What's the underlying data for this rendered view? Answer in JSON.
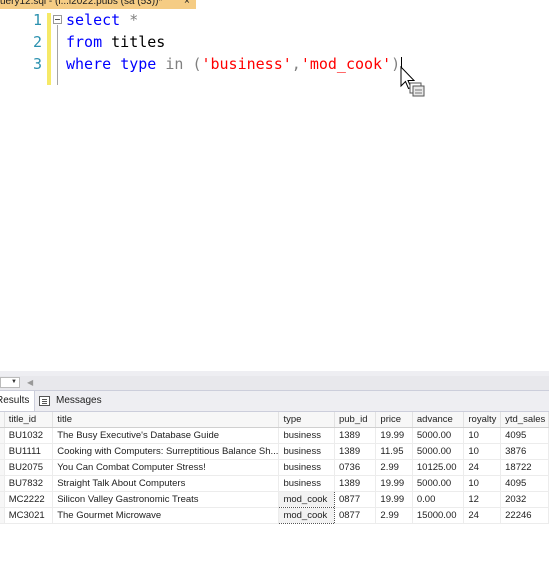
{
  "document_tab": {
    "label": "uery12.sql - (l...l2022.pubs (sa (53))*",
    "close": "×"
  },
  "editor": {
    "line_numbers": [
      "1",
      "2",
      "3"
    ],
    "lines": [
      [
        {
          "t": "select",
          "c": "kw"
        },
        {
          "t": " ",
          "c": "id"
        },
        {
          "t": "*",
          "c": "op"
        }
      ],
      [
        {
          "t": "from",
          "c": "kw"
        },
        {
          "t": " titles",
          "c": "id"
        }
      ],
      [
        {
          "t": "where",
          "c": "kw"
        },
        {
          "t": " ",
          "c": "id"
        },
        {
          "t": "type",
          "c": "kw"
        },
        {
          "t": " ",
          "c": "id"
        },
        {
          "t": "in",
          "c": "op"
        },
        {
          "t": " ",
          "c": "id"
        },
        {
          "t": "(",
          "c": "op"
        },
        {
          "t": "'business'",
          "c": "str"
        },
        {
          "t": ",",
          "c": "op"
        },
        {
          "t": "'mod_cook'",
          "c": "str"
        },
        {
          "t": ")",
          "c": "op"
        }
      ]
    ],
    "colors": {
      "keyword": "#0000ff",
      "operator": "#808080",
      "string": "#ff0000",
      "line_number": "#2b91af"
    }
  },
  "result_tabs": {
    "results_label": "Results",
    "messages_label": "Messages",
    "messages_icon": "messages-icon"
  },
  "grid": {
    "columns": [
      "title_id",
      "title",
      "type",
      "pub_id",
      "price",
      "advance",
      "royalty",
      "ytd_sales"
    ],
    "rows": [
      [
        "BU1032",
        "The Busy Executive's Database Guide",
        "business",
        "1389",
        "19.99",
        "5000.00",
        "10",
        "4095"
      ],
      [
        "BU1111",
        "Cooking with Computers: Surreptitious Balance Sh...",
        "business",
        "1389",
        "11.95",
        "5000.00",
        "10",
        "3876"
      ],
      [
        "BU2075",
        "You Can Combat Computer Stress!",
        "business",
        "0736",
        "2.99",
        "10125.00",
        "24",
        "18722"
      ],
      [
        "BU7832",
        "Straight Talk About Computers",
        "business",
        "1389",
        "19.99",
        "5000.00",
        "10",
        "4095"
      ],
      [
        "MC2222",
        "Silicon Valley Gastronomic Treats",
        "mod_cook",
        "0877",
        "19.99",
        "0.00",
        "12",
        "2032"
      ],
      [
        "MC3021",
        "The Gourmet Microwave",
        "mod_cook",
        "0877",
        "2.99",
        "15000.00",
        "24",
        "22246"
      ]
    ],
    "selected_cells": [
      [
        4,
        2
      ],
      [
        5,
        2
      ]
    ]
  }
}
